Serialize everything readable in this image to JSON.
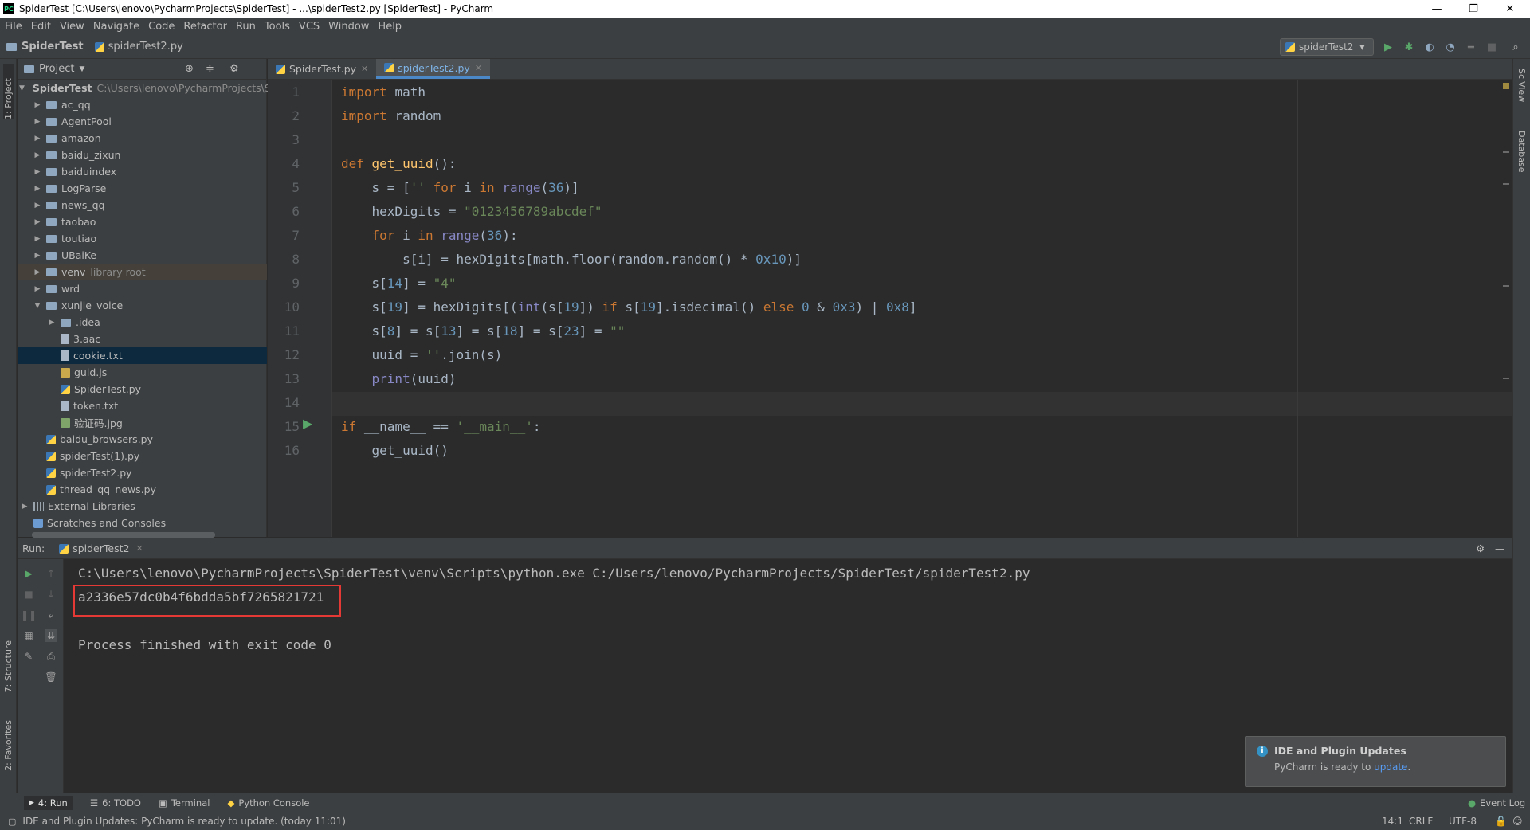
{
  "window": {
    "title": "SpiderTest [C:\\Users\\lenovo\\PycharmProjects\\SpiderTest] - ...\\spiderTest2.py [SpiderTest] - PyCharm",
    "app_icon": "PC",
    "controls": [
      "—",
      "❐",
      "✕"
    ]
  },
  "menu": [
    "File",
    "Edit",
    "View",
    "Navigate",
    "Code",
    "Refactor",
    "Run",
    "Tools",
    "VCS",
    "Window",
    "Help"
  ],
  "breadcrumb": {
    "project": "SpiderTest",
    "file": "spiderTest2.py"
  },
  "run_config": {
    "name": "spiderTest2",
    "arrow": "▾"
  },
  "left_strip": {
    "project": "1: Project",
    "structure": "7: Structure",
    "favorites": "2: Favorites"
  },
  "right_strip": {
    "sciview": "SciView",
    "database": "Database"
  },
  "project_panel": {
    "title": "Project",
    "root": {
      "name": "SpiderTest",
      "path": "C:\\Users\\lenovo\\PycharmProjects\\SpiderTest"
    },
    "items": [
      {
        "label": "ac_qq"
      },
      {
        "label": "AgentPool"
      },
      {
        "label": "amazon"
      },
      {
        "label": "baidu_zixun"
      },
      {
        "label": "baiduindex"
      },
      {
        "label": "LogParse"
      },
      {
        "label": "news_qq"
      },
      {
        "label": "taobao"
      },
      {
        "label": "toutiao"
      },
      {
        "label": "UBaiKe"
      },
      {
        "label": "venv",
        "note": "library root"
      },
      {
        "label": "wrd"
      },
      {
        "label": "xunjie_voice"
      },
      {
        "label": ".idea"
      },
      {
        "label": "3.aac"
      },
      {
        "label": "cookie.txt"
      },
      {
        "label": "guid.js"
      },
      {
        "label": "SpiderTest.py"
      },
      {
        "label": "token.txt"
      },
      {
        "label": "验证码.jpg"
      },
      {
        "label": "baidu_browsers.py"
      },
      {
        "label": "spiderTest(1).py"
      },
      {
        "label": "spiderTest2.py"
      },
      {
        "label": "thread_qq_news.py"
      },
      {
        "label": "External Libraries"
      },
      {
        "label": "Scratches and Consoles"
      }
    ]
  },
  "editor": {
    "tabs": [
      {
        "label": "SpiderTest.py"
      },
      {
        "label": "spiderTest2.py"
      }
    ],
    "line_numbers": [
      "1",
      "2",
      "3",
      "4",
      "5",
      "6",
      "7",
      "8",
      "9",
      "10",
      "11",
      "12",
      "13",
      "14",
      "15",
      "16"
    ]
  },
  "code_lines": [
    [
      {
        "t": "import ",
        "c": "kw"
      },
      {
        "t": "math",
        "c": "op"
      }
    ],
    [
      {
        "t": "import ",
        "c": "kw"
      },
      {
        "t": "random",
        "c": "op"
      }
    ],
    [],
    [
      {
        "t": "def ",
        "c": "kw"
      },
      {
        "t": "get_uuid",
        "c": "fn"
      },
      {
        "t": "():",
        "c": "op"
      }
    ],
    [
      {
        "t": "    s = [",
        "c": "op"
      },
      {
        "t": "''",
        "c": "str"
      },
      {
        "t": " for ",
        "c": "kw"
      },
      {
        "t": "i",
        "c": "op"
      },
      {
        "t": " in ",
        "c": "kw"
      },
      {
        "t": "range",
        "c": "bi"
      },
      {
        "t": "(",
        "c": "op"
      },
      {
        "t": "36",
        "c": "num"
      },
      {
        "t": ")]",
        "c": "op"
      }
    ],
    [
      {
        "t": "    hexDigits",
        "c": "op"
      },
      {
        "t": " = ",
        "c": "op"
      },
      {
        "t": "\"0123456789abcdef\"",
        "c": "str"
      }
    ],
    [
      {
        "t": "    for ",
        "c": "kw"
      },
      {
        "t": "i",
        "c": "op"
      },
      {
        "t": " in ",
        "c": "kw"
      },
      {
        "t": "range",
        "c": "bi"
      },
      {
        "t": "(",
        "c": "op"
      },
      {
        "t": "36",
        "c": "num"
      },
      {
        "t": "):",
        "c": "op"
      }
    ],
    [
      {
        "t": "        s[i] = hexDigits[math.floor(random.random() * ",
        "c": "op"
      },
      {
        "t": "0x10",
        "c": "num"
      },
      {
        "t": ")]",
        "c": "op"
      }
    ],
    [
      {
        "t": "    s[",
        "c": "op"
      },
      {
        "t": "14",
        "c": "num"
      },
      {
        "t": "] = ",
        "c": "op"
      },
      {
        "t": "\"4\"",
        "c": "str"
      }
    ],
    [
      {
        "t": "    s[",
        "c": "op"
      },
      {
        "t": "19",
        "c": "num"
      },
      {
        "t": "] = hexDigits[(",
        "c": "op"
      },
      {
        "t": "int",
        "c": "bi"
      },
      {
        "t": "(s[",
        "c": "op"
      },
      {
        "t": "19",
        "c": "num"
      },
      {
        "t": "]) ",
        "c": "op"
      },
      {
        "t": "if ",
        "c": "kw"
      },
      {
        "t": "s[",
        "c": "op"
      },
      {
        "t": "19",
        "c": "num"
      },
      {
        "t": "].isdecimal() ",
        "c": "op"
      },
      {
        "t": "else ",
        "c": "kw"
      },
      {
        "t": "0",
        "c": "num"
      },
      {
        "t": " & ",
        "c": "op"
      },
      {
        "t": "0x3",
        "c": "num"
      },
      {
        "t": ") | ",
        "c": "op"
      },
      {
        "t": "0x8",
        "c": "num"
      },
      {
        "t": "]",
        "c": "op"
      }
    ],
    [
      {
        "t": "    s[",
        "c": "op"
      },
      {
        "t": "8",
        "c": "num"
      },
      {
        "t": "] = s[",
        "c": "op"
      },
      {
        "t": "13",
        "c": "num"
      },
      {
        "t": "] = s[",
        "c": "op"
      },
      {
        "t": "18",
        "c": "num"
      },
      {
        "t": "] = s[",
        "c": "op"
      },
      {
        "t": "23",
        "c": "num"
      },
      {
        "t": "] = ",
        "c": "op"
      },
      {
        "t": "\"\"",
        "c": "str"
      }
    ],
    [
      {
        "t": "    uuid = ",
        "c": "op"
      },
      {
        "t": "''",
        "c": "str"
      },
      {
        "t": ".join(s)",
        "c": "op"
      }
    ],
    [
      {
        "t": "    ",
        "c": "op"
      },
      {
        "t": "print",
        "c": "bi"
      },
      {
        "t": "(uuid)",
        "c": "op"
      }
    ],
    [],
    [
      {
        "t": "if ",
        "c": "kw"
      },
      {
        "t": "__name__",
        "c": "op"
      },
      {
        "t": " == ",
        "c": "op"
      },
      {
        "t": "'__main__'",
        "c": "str"
      },
      {
        "t": ":",
        "c": "op"
      }
    ],
    [
      {
        "t": "    get_uuid()",
        "c": "op"
      }
    ]
  ],
  "run": {
    "label": "Run:",
    "tab": "spiderTest2",
    "command": "C:\\Users\\lenovo\\PycharmProjects\\SpiderTest\\venv\\Scripts\\python.exe C:/Users/lenovo/PycharmProjects/SpiderTest/spiderTest2.py",
    "output": "a2336e57dc0b4f6bdda5bf7265821721",
    "exit": "Process finished with exit code 0"
  },
  "notification": {
    "title": "IDE and Plugin Updates",
    "text": "PyCharm is ready to",
    "link": "update",
    "end": "."
  },
  "bottom_tabs": {
    "run": "4: Run",
    "todo": "6: TODO",
    "terminal": "Terminal",
    "console": "Python Console",
    "event_log": "Event Log"
  },
  "status": {
    "message": "IDE and Plugin Updates: PyCharm is ready to update. (today 11:01)",
    "position": "14:1",
    "line_sep": "CRLF",
    "encoding": "UTF-8"
  },
  "colors": {
    "keyword": "#cc7832",
    "function": "#ffc66d",
    "number": "#6897bb",
    "string": "#6a8759",
    "builtin": "#8888c6",
    "highlight_box": "#e53935",
    "accent": "#4a88c7"
  }
}
